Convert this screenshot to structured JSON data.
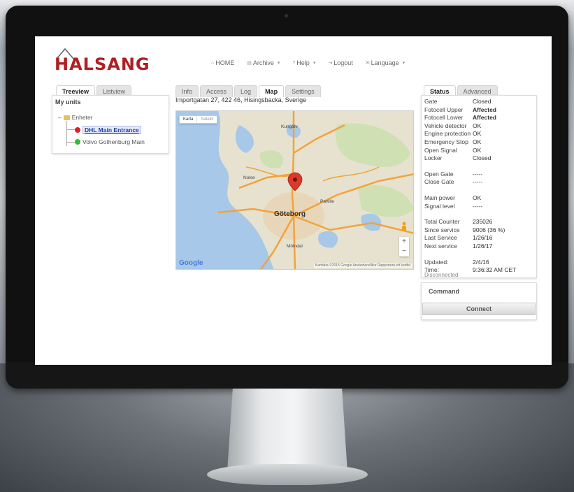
{
  "brand": {
    "name": "HALSANG",
    "color": "#b01e24"
  },
  "nav": [
    {
      "label": "HOME",
      "icon": "home-icon",
      "glyph": "⌂",
      "has_menu": false
    },
    {
      "label": "Archive",
      "icon": "archive-icon",
      "glyph": "▤",
      "has_menu": true
    },
    {
      "label": "Help",
      "icon": "help-icon",
      "glyph": "?",
      "has_menu": true
    },
    {
      "label": "Logout",
      "icon": "logout-icon",
      "glyph": "⇥",
      "has_menu": false
    },
    {
      "label": "Language",
      "icon": "language-icon",
      "glyph": "✉",
      "has_menu": true
    }
  ],
  "left_tabs": [
    {
      "label": "Treeview",
      "active": true
    },
    {
      "label": "Listview",
      "active": false
    }
  ],
  "tree": {
    "heading": "My units",
    "root": {
      "toggle": "–",
      "label": "Enheter"
    },
    "units": [
      {
        "label": "DHL Main Entrance",
        "status_color": "#e02020",
        "selected": true
      },
      {
        "label": "Volvo Gothenburg Main",
        "status_color": "#2ec02e",
        "selected": false
      }
    ]
  },
  "center_tabs": [
    {
      "label": "Info",
      "active": false
    },
    {
      "label": "Access",
      "active": false
    },
    {
      "label": "Log",
      "active": false
    },
    {
      "label": "Map",
      "active": true
    },
    {
      "label": "Settings",
      "active": false
    }
  ],
  "address": "Importgatan 27, 422 46, Hisingsbacka, Sverige",
  "map": {
    "toggle": [
      "Karta",
      "Satellit"
    ],
    "city_label": "Göteborg",
    "place_labels": [
      "Kungälv",
      "Nolse",
      "Mölndal",
      "Partille"
    ],
    "zoom_in": "+",
    "zoom_out": "−",
    "provider": "Google",
    "copyright": "Kartdata ©2015 Google  Användarvillkor  Rapportera ett kartfel",
    "land_color": "#e6e2cf",
    "water_color": "#a7c8e8",
    "road_color": "#f2a33a"
  },
  "right_tabs": [
    {
      "label": "Status",
      "active": true
    },
    {
      "label": "Advanced",
      "active": false
    }
  ],
  "status": {
    "groups": [
      [
        {
          "key": "Gate",
          "value": "Closed",
          "state": "ok"
        },
        {
          "key": "Fotocell Upper",
          "value": "Affected",
          "state": "bad"
        },
        {
          "key": "Fotocell Lower",
          "value": "Affected",
          "state": "bad"
        },
        {
          "key": "Vehicle detector",
          "value": "OK",
          "state": "ok"
        },
        {
          "key": "Engine protection",
          "value": "OK",
          "state": "ok"
        },
        {
          "key": "Emergency Stop",
          "value": "OK",
          "state": "ok"
        },
        {
          "key": "Open Signal",
          "value": "OK",
          "state": "ok"
        },
        {
          "key": "Locker",
          "value": "Closed",
          "state": "ok"
        }
      ],
      [
        {
          "key": "Open Gate",
          "value": "-----",
          "state": "plain"
        },
        {
          "key": "Close Gate",
          "value": "-----",
          "state": "plain"
        }
      ],
      [
        {
          "key": "Main power",
          "value": "OK",
          "state": "ok"
        },
        {
          "key": "Signal level",
          "value": "-----",
          "state": "plain"
        }
      ],
      [
        {
          "key": "Total Counter",
          "value": "235026",
          "state": "plain"
        },
        {
          "key": "Since service",
          "value": "9006 (36 %)",
          "state": "ok"
        },
        {
          "key": "Last Service",
          "value": "1/26/16",
          "state": "plain"
        },
        {
          "key": "Next service",
          "value": "1/26/17",
          "state": "plain"
        }
      ],
      [
        {
          "key": "Updated:",
          "value": "2/4/16",
          "state": "plain"
        },
        {
          "key": "Time:",
          "value": "9:36:32 AM CET",
          "state": "plain"
        }
      ]
    ],
    "connection": "Disconnected",
    "ok_color": "#2e9d2e",
    "bad_color": "#e02020"
  },
  "command": {
    "title": "Command",
    "connect_label": "Connect"
  }
}
